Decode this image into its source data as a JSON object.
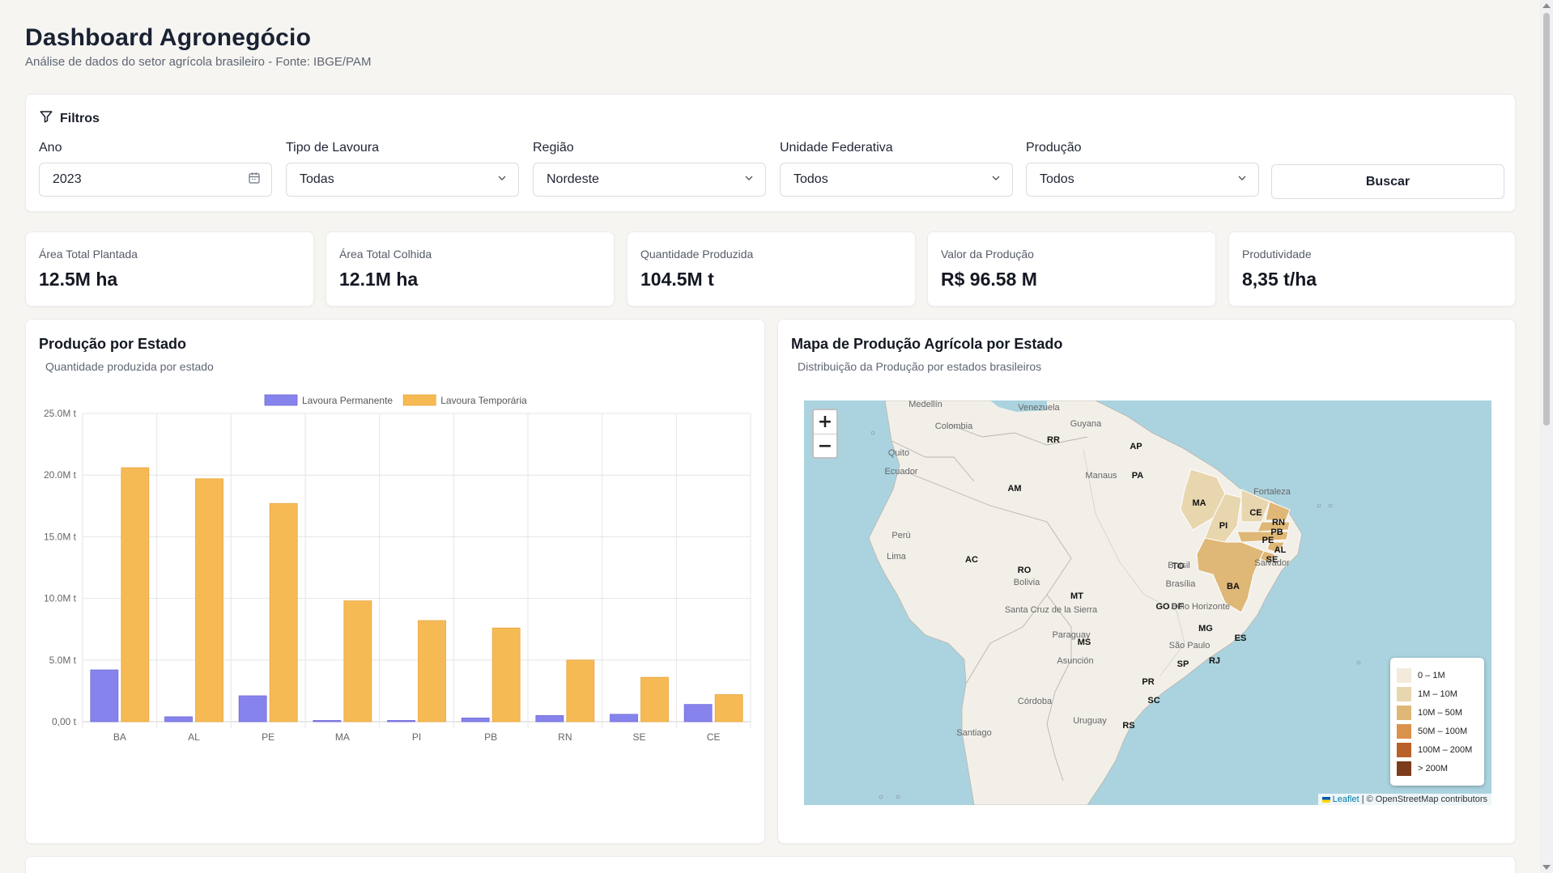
{
  "header": {
    "title": "Dashboard Agronegócio",
    "subtitle": "Análise de dados do setor agrícola brasileiro - Fonte: IBGE/PAM"
  },
  "filters": {
    "heading": "Filtros",
    "icon": "filter-icon",
    "ano": {
      "label": "Ano",
      "value": "2023",
      "icon": "calendar-icon"
    },
    "tipo": {
      "label": "Tipo de Lavoura",
      "value": "Todas"
    },
    "regiao": {
      "label": "Região",
      "value": "Nordeste"
    },
    "uf": {
      "label": "Unidade Federativa",
      "value": "Todos"
    },
    "producao": {
      "label": "Produção",
      "value": "Todos"
    },
    "search_label": "Buscar"
  },
  "kpis": [
    {
      "label": "Área Total Plantada",
      "value": "12.5M ha"
    },
    {
      "label": "Área Total Colhida",
      "value": "12.1M ha"
    },
    {
      "label": "Quantidade Produzida",
      "value": "104.5M t"
    },
    {
      "label": "Valor da Produção",
      "value": "R$ 96.58 M"
    },
    {
      "label": "Produtividade",
      "value": "8,35 t/ha"
    }
  ],
  "bar_panel": {
    "title": "Produção por Estado",
    "subtitle": "Quantidade produzida por estado"
  },
  "map_panel": {
    "title": "Mapa de Produção Agrícola por Estado",
    "subtitle": "Distribuição da Produção por estados brasileiros",
    "zoom_in": "+",
    "zoom_out": "−",
    "attribution_link": "Leaflet",
    "attribution_text": "| © OpenStreetMap contributors",
    "legend": [
      {
        "label": "0 – 1M",
        "color": "#f2ebdc"
      },
      {
        "label": "1M – 10M",
        "color": "#e8d6ae"
      },
      {
        "label": "10M – 50M",
        "color": "#dfb777"
      },
      {
        "label": "50M – 100M",
        "color": "#d9914c"
      },
      {
        "label": "100M – 200M",
        "color": "#b9612a"
      },
      {
        "label": "> 200M",
        "color": "#7c3d1c"
      }
    ],
    "state_labels": [
      "RR",
      "AP",
      "PA",
      "AM",
      "MA",
      "CE",
      "RN",
      "PI",
      "PB",
      "PE",
      "AL",
      "SE",
      "TO",
      "BA",
      "AC",
      "RO",
      "MT",
      "GO",
      "DF",
      "MG",
      "ES",
      "MS",
      "SP",
      "RJ",
      "PR",
      "SC",
      "RS"
    ],
    "place_labels": [
      "Medellín",
      "Venezuela",
      "Guyana",
      "Colombia",
      "Quito",
      "Ecuador",
      "Manaus",
      "Perú",
      "Lima",
      "Fortaleza",
      "Brasil",
      "Brasília",
      "Salvador",
      "Bolivia",
      "Santa Cruz de la Sierra",
      "Belo Horizonte",
      "Paraguay",
      "Asunción",
      "São Paulo",
      "Córdoba",
      "Uruguay",
      "Santiago"
    ]
  },
  "chart_data": {
    "type": "bar",
    "title": "",
    "categories": [
      "BA",
      "AL",
      "PE",
      "MA",
      "PI",
      "PB",
      "RN",
      "SE",
      "CE"
    ],
    "series": [
      {
        "name": "Lavoura Permanente",
        "color": "#8783ec",
        "values": [
          4.2,
          0.4,
          2.1,
          0.1,
          0.1,
          0.3,
          0.5,
          0.6,
          1.4
        ]
      },
      {
        "name": "Lavoura Temporária",
        "color": "#f6ba55",
        "values": [
          20.6,
          19.7,
          17.7,
          9.8,
          8.2,
          7.6,
          5.0,
          3.6,
          2.2
        ]
      }
    ],
    "y_ticks": [
      "0,00 t",
      "5.0M t",
      "10.0M t",
      "15.0M t",
      "20.0M t",
      "25.0M t"
    ],
    "ylim": [
      0,
      25
    ],
    "xlabel": "",
    "ylabel": "",
    "grid": true,
    "legend_position": "top"
  }
}
